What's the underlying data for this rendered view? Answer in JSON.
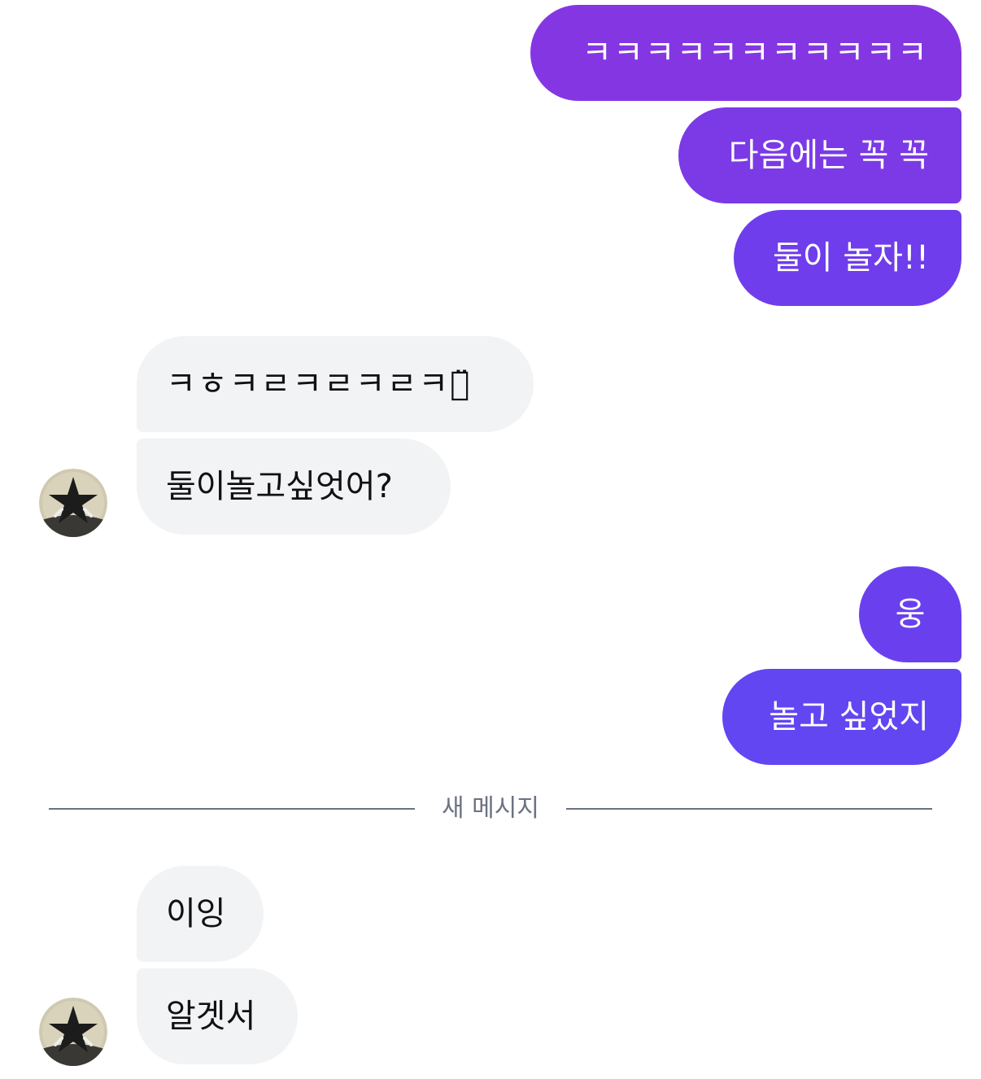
{
  "thread": {
    "sent_group_1": [
      "ㅋㅋㅋㅋㅋㅋㅋㅋㅋㅋㅋ",
      "다음에는 꼭 꼭",
      "둘이 놀자!!"
    ],
    "received_group_1": [
      "ㅋㅎㅋㄹㅋㄹㅋㄹㅋㅋ̈",
      "둘이놀고싶엇어?"
    ],
    "sent_group_2": [
      "웅",
      "놀고 싶었지"
    ],
    "divider_label": "새 메시지",
    "received_group_2": [
      "이잉",
      "알겟서"
    ]
  },
  "colors": {
    "sent_top": "#8536e3",
    "sent_mid": "#7a3be8",
    "sent_low": "#6c3fef",
    "sent_bottom": "#6146f2",
    "received_bg": "#f2f3f5",
    "divider": "#6b7280"
  },
  "icons": {
    "avatar": "star-avatar-icon"
  }
}
